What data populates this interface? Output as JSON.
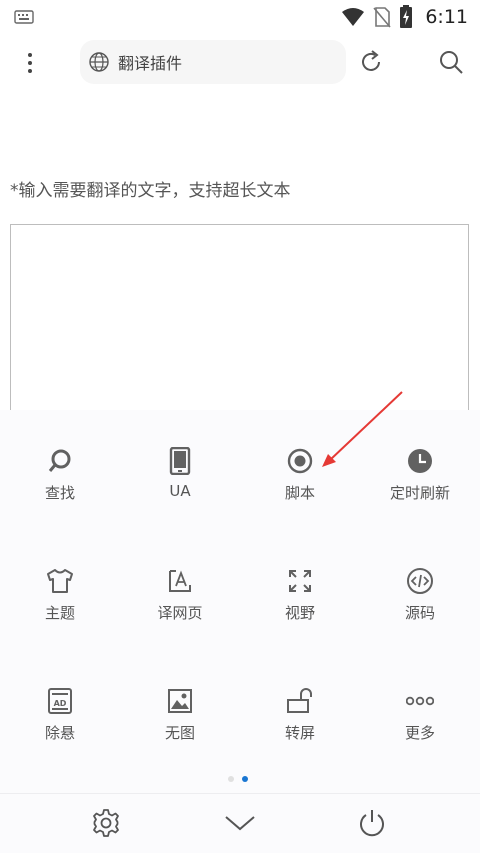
{
  "status_bar": {
    "time": "6:11",
    "icons": [
      "keyboard-icon",
      "wifi-icon",
      "no-sim-icon",
      "battery-charging-icon"
    ]
  },
  "toolbar": {
    "menu_icon": "more-vert-icon",
    "url_text": "翻译插件",
    "globe_icon": "globe-icon",
    "refresh_icon": "refresh-icon",
    "search_icon": "search-icon"
  },
  "content": {
    "prompt": "*输入需要翻译的文字，支持超长文本",
    "textbox_value": ""
  },
  "menu": {
    "rows": [
      [
        {
          "label": "查找",
          "icon": "search-icon"
        },
        {
          "label": "UA",
          "icon": "tablet-icon"
        },
        {
          "label": "脚本",
          "icon": "radio-button-icon"
        },
        {
          "label": "定时刷新",
          "icon": "clock-icon"
        }
      ],
      [
        {
          "label": "主题",
          "icon": "tshirt-icon"
        },
        {
          "label": "译网页",
          "icon": "translate-page-icon"
        },
        {
          "label": "视野",
          "icon": "fullscreen-icon"
        },
        {
          "label": "源码",
          "icon": "source-code-icon"
        }
      ],
      [
        {
          "label": "除悬",
          "icon": "remove-float-icon"
        },
        {
          "label": "无图",
          "icon": "image-icon"
        },
        {
          "label": "转屏",
          "icon": "rotate-screen-icon"
        },
        {
          "label": "更多",
          "icon": "more-horiz-icon"
        }
      ]
    ],
    "page_indicator": {
      "pages": 2,
      "active": 2
    }
  },
  "bottom_bar": {
    "icons": [
      "settings-icon",
      "chevron-down-icon",
      "power-icon"
    ]
  },
  "colors": {
    "accent": "#1976d2",
    "annotation_arrow": "#e53935",
    "icon_gray": "#616161"
  }
}
